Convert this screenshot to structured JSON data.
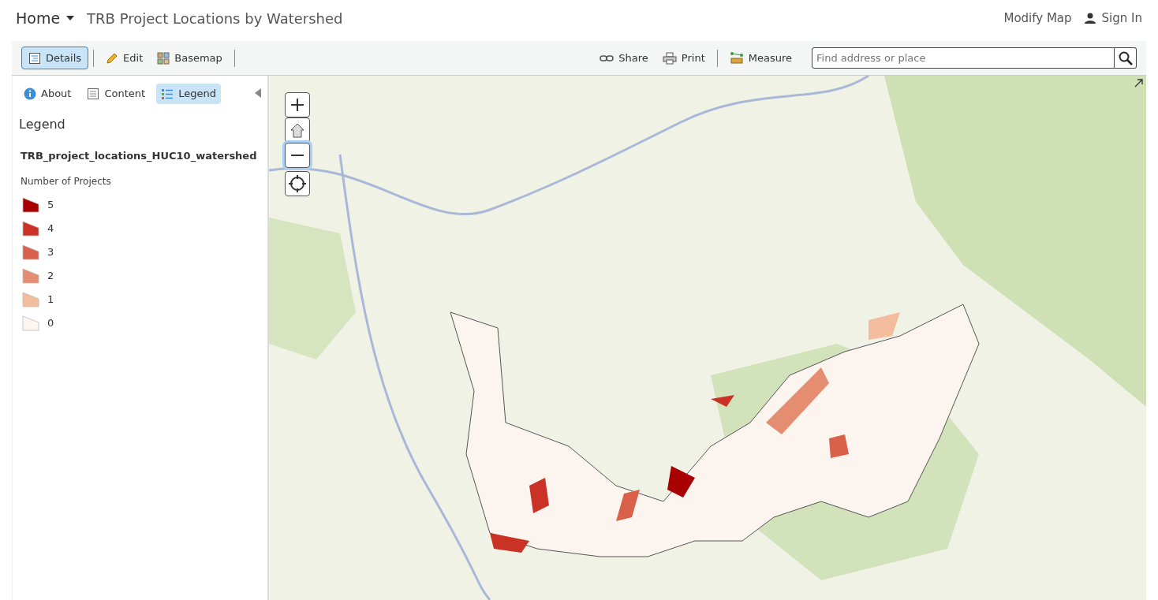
{
  "header": {
    "home_menu": "Home",
    "title": "TRB Project Locations by Watershed",
    "links": [
      {
        "label": "Modify Map",
        "kind": "text"
      },
      {
        "label": "Sign In",
        "kind": "user"
      }
    ]
  },
  "toolbar": {
    "left_groups": [
      [
        {
          "label": "Details",
          "kind": "details",
          "selected": true
        }
      ],
      [
        {
          "label": "Edit",
          "kind": "edit",
          "selected": false
        },
        {
          "label": "Basemap",
          "kind": "basemap",
          "selected": false
        }
      ]
    ],
    "right_groups": [
      [
        {
          "label": "Share",
          "kind": "share"
        },
        {
          "label": "Print",
          "kind": "print"
        }
      ],
      [
        {
          "label": "Measure",
          "kind": "measure"
        }
      ]
    ],
    "search": {
      "placeholder": "Find address or place"
    }
  },
  "sidebar": {
    "tabs": [
      {
        "label": "About",
        "kind": "about",
        "selected": false
      },
      {
        "label": "Content",
        "kind": "content",
        "selected": false
      },
      {
        "label": "Legend",
        "kind": "legend",
        "selected": true
      }
    ],
    "heading": "Legend",
    "layer": "TRB_project_locations_HUC10_watershed",
    "field": "Number of Projects",
    "legend": [
      {
        "label": "5",
        "color": "#a80000"
      },
      {
        "label": "4",
        "color": "#cb3226"
      },
      {
        "label": "3",
        "color": "#d9614a"
      },
      {
        "label": "2",
        "color": "#e48d70"
      },
      {
        "label": "1",
        "color": "#f3bc9c"
      },
      {
        "label": "0",
        "color": "#fdf5ef"
      }
    ]
  }
}
